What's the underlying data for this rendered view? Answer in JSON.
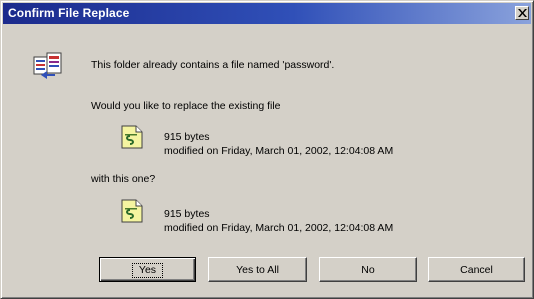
{
  "dialog": {
    "title": "Confirm File Replace",
    "message": "This folder already contains a file named 'password'.",
    "question": "Would you like to replace the existing file",
    "with_label": "with this one?"
  },
  "existing_file": {
    "size": "915 bytes",
    "modified": "modified on Friday, March 01, 2002, 12:04:08 AM",
    "icon": "text-file-icon"
  },
  "new_file": {
    "size": "915 bytes",
    "modified": "modified on Friday, March 01, 2002, 12:04:08 AM",
    "icon": "text-file-icon"
  },
  "buttons": {
    "yes": "Yes",
    "yes_to_all": "Yes to All",
    "no": "No",
    "cancel": "Cancel"
  },
  "colors": {
    "titlebar_start": "#1b2a8c",
    "titlebar_end": "#8aa2dc",
    "dialog_face": "#d4d0c8"
  }
}
